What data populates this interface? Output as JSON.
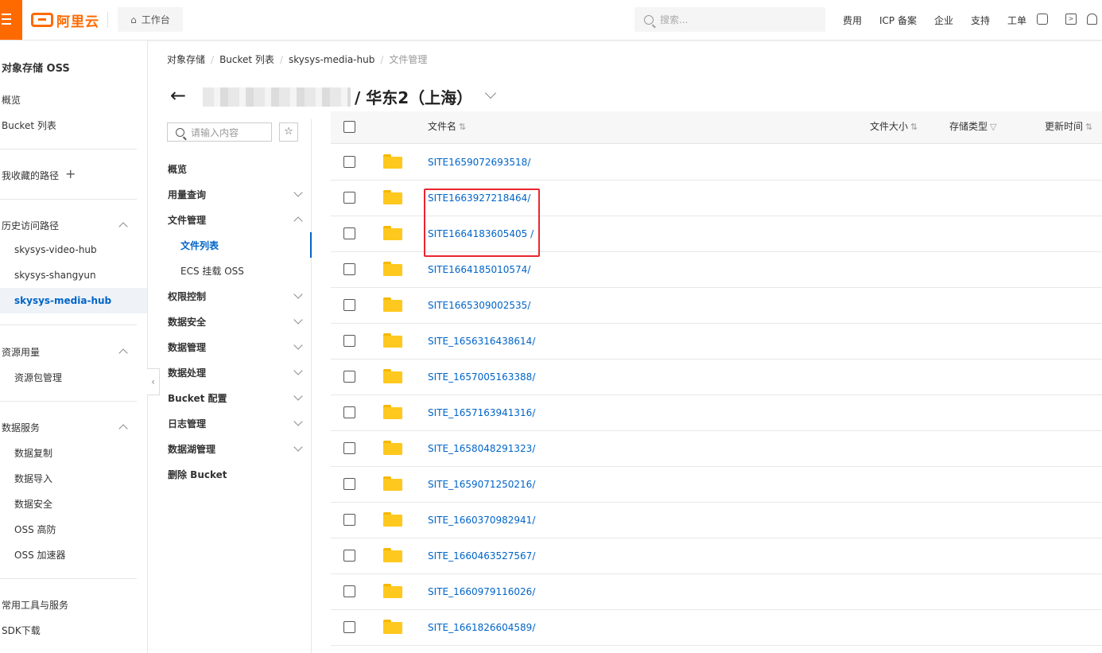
{
  "topbar": {
    "logo_text": "阿里云",
    "workbench": "工作台",
    "search_placeholder": "搜索...",
    "links": [
      "费用",
      "ICP 备案",
      "企业",
      "支持",
      "工单"
    ]
  },
  "leftnav": {
    "title": "对象存储 OSS",
    "overview": "概览",
    "bucket_list": "Bucket 列表",
    "favorites": "我收藏的路径",
    "history": "历史访问路径",
    "history_items": [
      "skysys-video-hub",
      "skysys-shangyun",
      "skysys-media-hub"
    ],
    "resources": "资源用量",
    "resources_items": [
      "资源包管理"
    ],
    "data_services": "数据服务",
    "data_services_items": [
      "数据复制",
      "数据导入",
      "数据安全",
      "OSS 高防",
      "OSS 加速器"
    ],
    "tools": "常用工具与服务",
    "sdk": "SDK下载"
  },
  "breadcrumb": [
    "对象存储",
    "Bucket 列表",
    "skysys-media-hub",
    "文件管理"
  ],
  "page_title": "/ 华东2（上海）",
  "secnav": {
    "search_placeholder": "请输入内容",
    "items": {
      "overview": "概览",
      "usage": "用量查询",
      "files": "文件管理",
      "file_list": "文件列表",
      "ecs_mount": "ECS 挂载 OSS",
      "permissions": "权限控制",
      "data_security": "数据安全",
      "data_management": "数据管理",
      "data_processing": "数据处理",
      "bucket_config": "Bucket 配置",
      "logs": "日志管理",
      "data_lake": "数据湖管理",
      "delete_bucket": "删除 Bucket"
    }
  },
  "table": {
    "headers": {
      "name": "文件名",
      "size": "文件大小",
      "storage_type": "存储类型",
      "updated": "更新时间"
    },
    "rows": [
      "SITE1659072693518/",
      "SITE1663927218464/",
      "SITE1664183605405 /",
      "SITE1664185010574/",
      "SITE1665309002535/",
      "SITE_1656316438614/",
      "SITE_1657005163388/",
      "SITE_1657163941316/",
      "SITE_1658048291323/",
      "SITE_1659071250216/",
      "SITE_1660370982941/",
      "SITE_1660463527567/",
      "SITE_1660979116026/",
      "SITE_1661826604589/"
    ]
  },
  "colors": {
    "brand": "#ff6a00",
    "link": "#0064c8",
    "highlight_box": "#e8262f",
    "folder": "#ffc81e"
  }
}
